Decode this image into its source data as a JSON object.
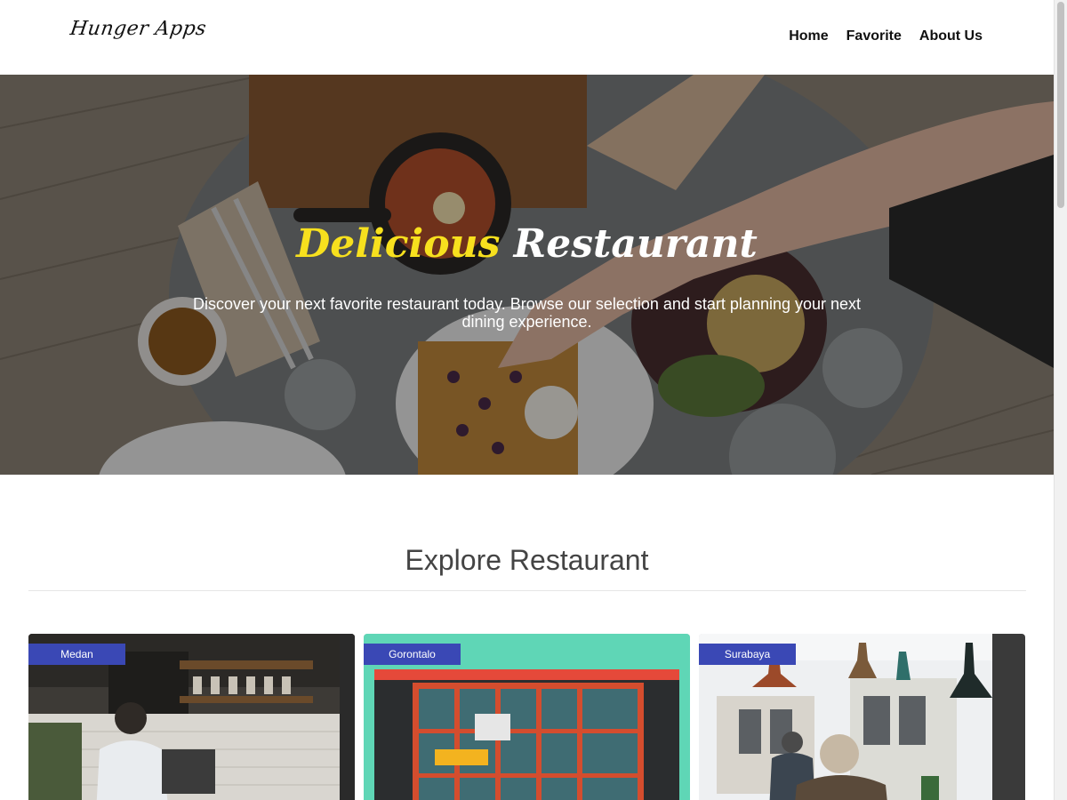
{
  "header": {
    "logo": "Hunger Apps",
    "nav": [
      {
        "label": "Home"
      },
      {
        "label": "Favorite"
      },
      {
        "label": "About Us"
      }
    ]
  },
  "hero": {
    "title_accent": "Delicious",
    "title_rest": "Restaurant",
    "subtitle": "Discover your next favorite restaurant today. Browse our selection and start planning your next dining experience."
  },
  "explore": {
    "title": "Explore Restaurant",
    "cards": [
      {
        "city": "Medan"
      },
      {
        "city": "Gorontalo"
      },
      {
        "city": "Surabaya"
      }
    ]
  },
  "colors": {
    "accent_yellow": "#f7e01e",
    "badge_blue": "#3a48b5"
  }
}
